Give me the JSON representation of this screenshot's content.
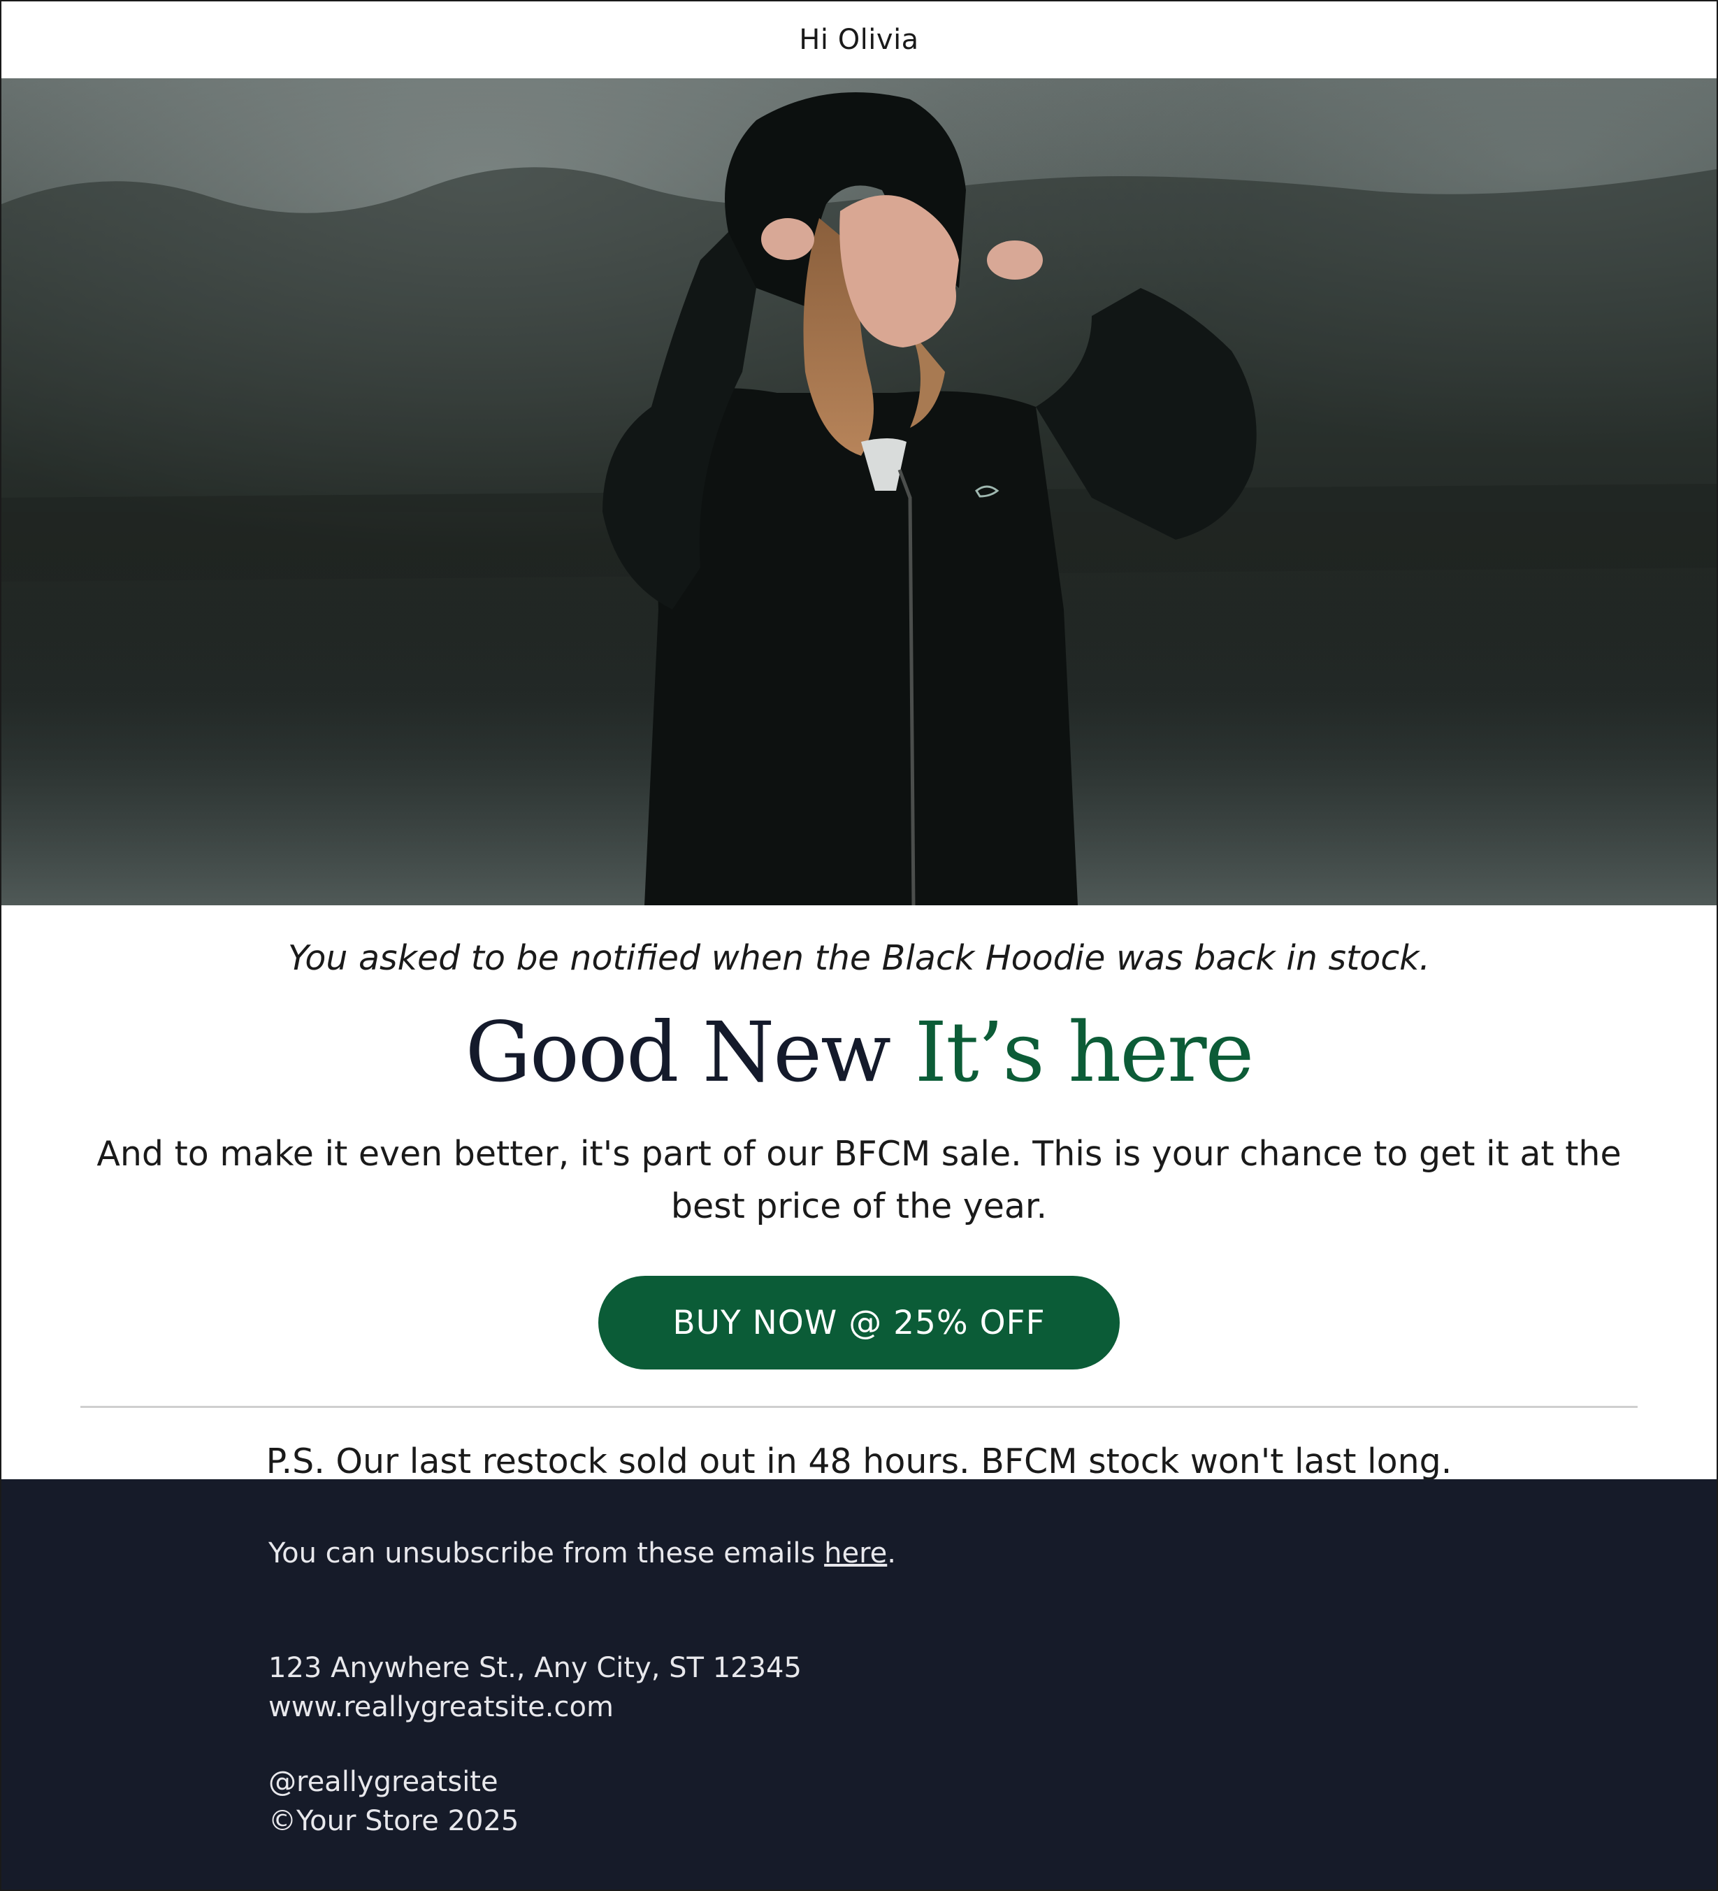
{
  "header": {
    "greeting": "Hi Olivia"
  },
  "hero": {
    "alt": "Woman in a black velvet hoodie pulling up her hood beside a misty forest lake"
  },
  "main": {
    "notice": "You asked to be notified when the Black Hoodie was back in stock.",
    "headline_dark": "Good New",
    "headline_green": "It’s here",
    "body": "And to make it even better, it's part of our BFCM sale. This is your chance to get it at the best price of the year.",
    "cta_label": "BUY NOW @ 25% OFF",
    "ps": "P.S. Our last restock sold out in 48 hours. BFCM stock won't last long."
  },
  "footer": {
    "unsubscribe_prefix": "You can unsubscribe from these emails ",
    "unsubscribe_link": "here",
    "unsubscribe_suffix": ".",
    "address": "123 Anywhere St., Any City, ST 12345",
    "website": "www.reallygreatsite.com",
    "handle": "@reallygreatsite",
    "copyright": "©Your Store 2025"
  },
  "colors": {
    "brand_green": "#0b5c37",
    "headline_dark": "#141a2b",
    "footer_bg": "#161b29"
  }
}
